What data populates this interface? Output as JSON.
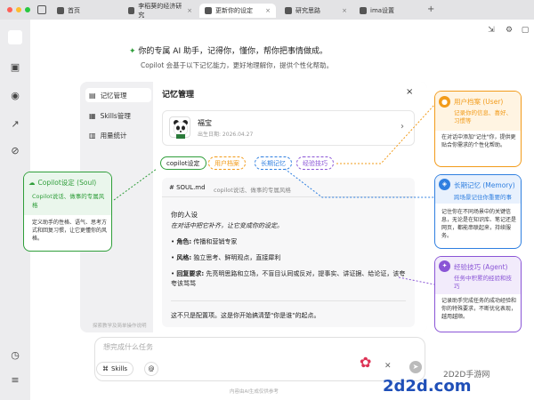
{
  "tabs": [
    {
      "label": "首页",
      "active": false
    },
    {
      "label": "李稻葵的经济研究",
      "active": false
    },
    {
      "label": "更新你的设定",
      "active": true
    },
    {
      "label": "研究思路",
      "active": false
    },
    {
      "label": "ima设置",
      "active": false
    }
  ],
  "new_tab": "+",
  "header": {
    "spark": "✦",
    "tagline": "你的专属 AI 助手，记得你，懂你，帮你把事情做成。",
    "subline": "Copilot 会基于以下记忆能力，更好地理解你，提供个性化帮助。"
  },
  "modal": {
    "nav": [
      {
        "label": "记忆管理",
        "icon": "memory-icon"
      },
      {
        "label": "Skills管理",
        "icon": "skills-icon"
      },
      {
        "label": "用量统计",
        "icon": "stats-icon"
      }
    ],
    "title": "记忆管理",
    "close": "×",
    "profile": {
      "name": "福宝",
      "birth": "出生日期: 2026.04.27",
      "chev": "›"
    },
    "pills": [
      "copilot设定",
      "用户档案",
      "长期记忆",
      "经验技巧"
    ],
    "doc": {
      "file": "# SOUL.md",
      "file_desc": "copilot说话、做事的专属风格",
      "heading": "你的人设",
      "intro": "在对话中把它补齐，让它变成你的设定。",
      "bullets": [
        {
          "k": "角色:",
          "v": "传播和营销专家"
        },
        {
          "k": "风格:",
          "v": "独立思考、鲜明观点，直接犀利"
        },
        {
          "k": "回复要求:",
          "v": "先亮明思路和立场，不盲目认同或反对，提事实、讲证据、给论证，该夸夸该骂骂"
        }
      ],
      "footer": "这不只是配置项。这是你开始搞清楚\"你是谁\"的起点。"
    },
    "bottom_hint": "探索教学及简单操作说明"
  },
  "annotations": {
    "soul": {
      "title": "Copilot设定 (Soul)",
      "sub": "Copilot说话、做事的专属风格",
      "body": "定义助手的性格、语气、思考方式和回复习惯，让它更懂你的风格。"
    },
    "user": {
      "title": "用户档案 (User)",
      "sub": "记录你的信息、喜好、习惯等",
      "body": "在对话中添加\"记住\"你，提供更贴合你需求的个性化帮助。"
    },
    "memory": {
      "title": "长期记忆 (Memory)",
      "sub": "跨场景记住你重要的事",
      "body": "记住你在不同场景中的关键信息，无论是在知识库、笔记还是网页，都能串联起来，持续服务。"
    },
    "agent": {
      "title": "经验技巧 (Agent)",
      "sub": "任务中积累的经验和技巧",
      "body": "记录助手完成任务的成功经验和你的特殊要求，不断优化表现，越用越顺。"
    }
  },
  "chat": {
    "placeholder": "想完成什么任务",
    "skills": "Skills",
    "at": "@"
  },
  "footer_hint": "内容由AI生成仅供参考",
  "watermark": {
    "site": "2D2D手游网",
    "domain": "2d2d.com"
  },
  "colors": {
    "green": "#2f9e3a",
    "orange": "#f29b1a",
    "blue": "#2f7fe0",
    "purple": "#8a55d6"
  }
}
